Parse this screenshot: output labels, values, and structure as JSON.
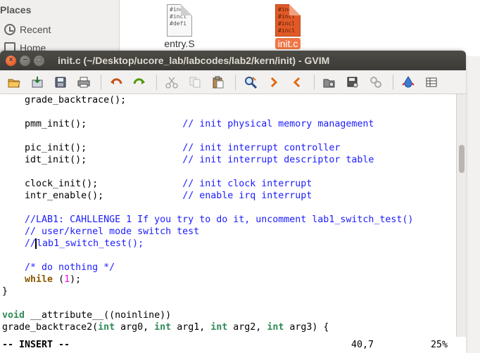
{
  "background": {
    "places_label": "Places",
    "sidebar_items": [
      "Recent",
      "Home"
    ],
    "files": [
      {
        "name": "entry.S",
        "preview": [
          "#incl",
          "#incl",
          "",
          "#defi"
        ]
      },
      {
        "name": "init.c",
        "preview": [
          "#incl",
          "#incl",
          "#incl",
          "#incl"
        ]
      }
    ]
  },
  "window": {
    "title": "init.c (~/Desktop/ucore_lab/labcodes/lab2/kern/init) - GVIM",
    "close_glyph": "×",
    "minimize_glyph": "−",
    "maximize_glyph": "□"
  },
  "toolbar": {
    "icons": [
      "open-icon",
      "save-file-icon",
      "save-all-icon",
      "print-icon",
      "undo-icon",
      "redo-icon",
      "cut-icon",
      "copy-icon",
      "paste-icon",
      "find-replace-icon",
      "find-next-icon",
      "find-prev-icon",
      "load-session-icon",
      "save-session-icon",
      "run-script-icon",
      "make-icon",
      "tags-icon"
    ]
  },
  "editor": {
    "lines": [
      "    grade_backtrace();",
      "",
      "    pmm_init();                 // init physical memory management",
      "",
      "    pic_init();                 // init interrupt controller",
      "    idt_init();                 // init interrupt descriptor table",
      "",
      "    clock_init();               // init clock interrupt",
      "    intr_enable();              // enable irq interrupt",
      "",
      "    //LAB1: CAHLLENGE 1 If you try to do it, uncomment lab1_switch_test()",
      "    // user/kernel mode switch test",
      "    //lab1_switch_test();",
      "",
      "    /* do nothing */",
      "    while (1);",
      "}",
      "",
      "void __attribute__((noinline))",
      "grade_backtrace2(int arg0, int arg1, int arg2, int arg3) {"
    ]
  },
  "status": {
    "mode": "-- INSERT --",
    "position": "40,7",
    "percent": "25%"
  },
  "colors": {
    "comment": "#1c1cff",
    "type": "#2e8b57",
    "keyword": "#8b5a00",
    "number": "#ff00ff",
    "titlebar": "#3c3b37",
    "close_button": "#df4a16"
  }
}
